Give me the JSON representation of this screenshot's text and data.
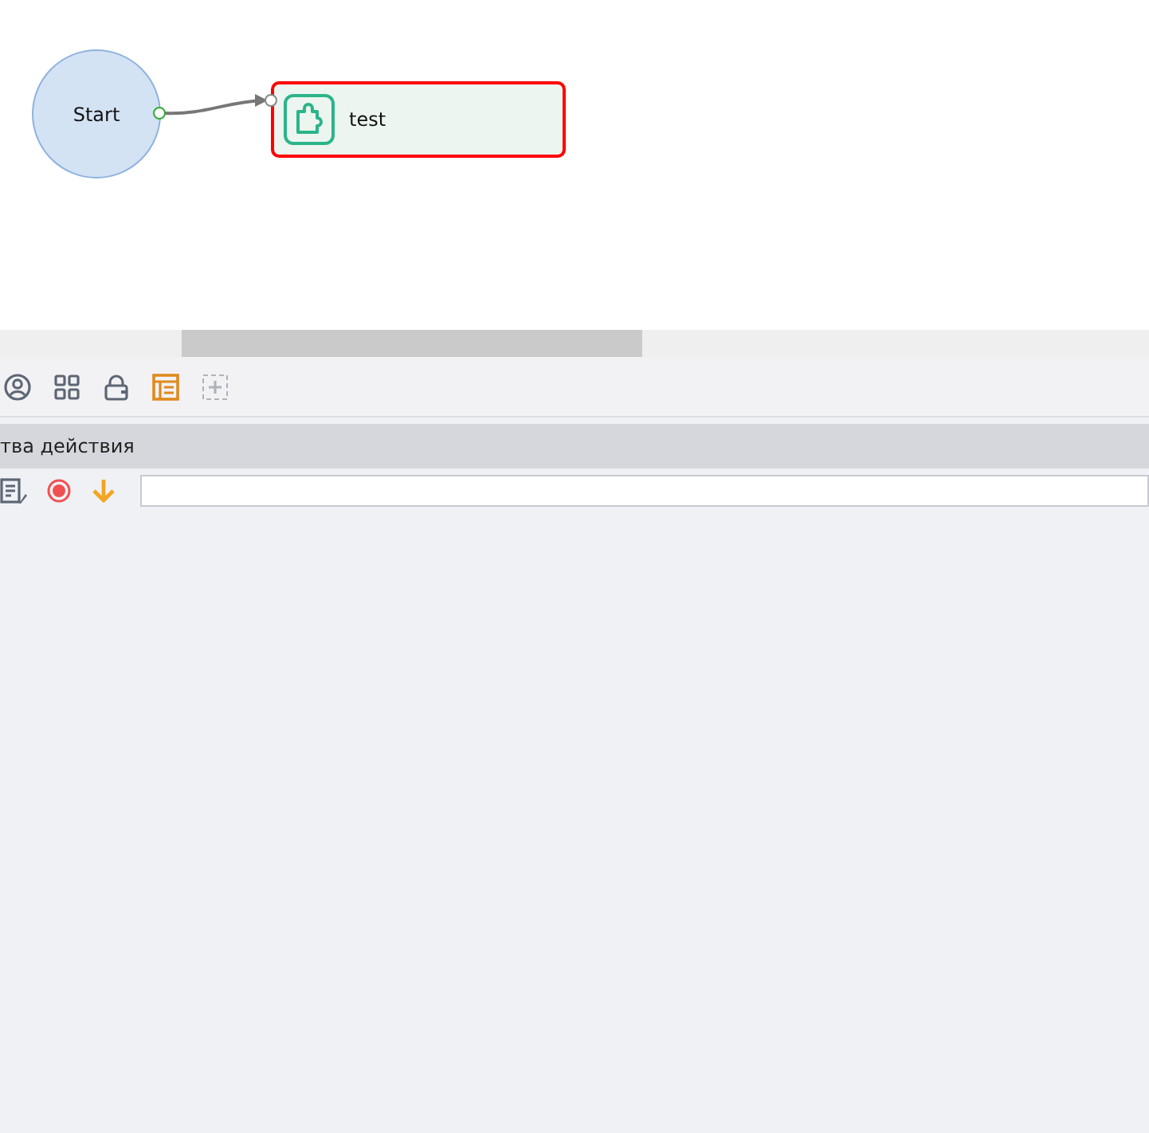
{
  "canvas": {
    "nodes": [
      {
        "kind": "start",
        "label": "Start",
        "selected": false
      },
      {
        "kind": "block",
        "label": "test",
        "selected": true
      }
    ]
  },
  "toolbar": {
    "buttons": [
      {
        "kind": "user",
        "active": false,
        "disabled": false
      },
      {
        "kind": "grid",
        "active": false,
        "disabled": false
      },
      {
        "kind": "lock",
        "active": false,
        "disabled": false
      },
      {
        "kind": "table",
        "active": true,
        "disabled": false
      },
      {
        "kind": "add",
        "active": false,
        "disabled": true
      }
    ]
  },
  "properties_panel": {
    "title": "тва действия",
    "tools": [
      {
        "kind": "notes"
      },
      {
        "kind": "record"
      },
      {
        "kind": "down"
      }
    ]
  }
}
